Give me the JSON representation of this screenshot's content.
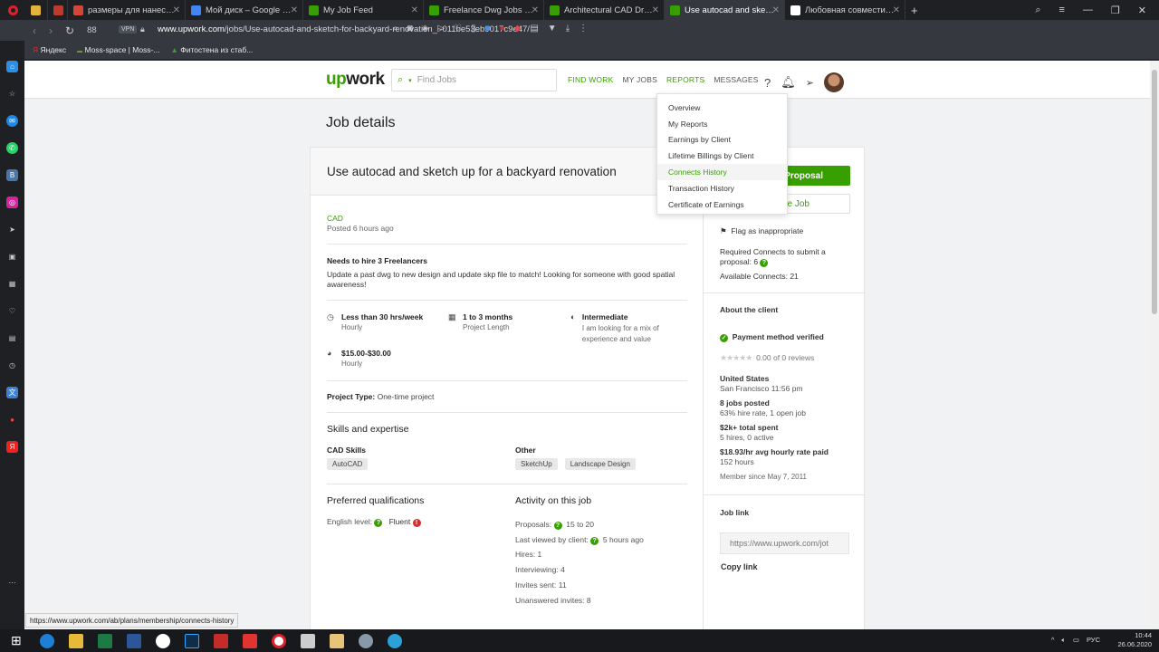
{
  "tabs": [
    {
      "title": "",
      "color": "#e3b33b"
    },
    {
      "title": "",
      "color": "#c0392b"
    },
    {
      "title": "размеры для нанесения с",
      "color": "#d44638"
    },
    {
      "title": "Мой диск – Google Диск",
      "color": "#4285f4"
    },
    {
      "title": "My Job Feed",
      "color": "#37a000"
    },
    {
      "title": "Freelance Dwg Jobs Online",
      "color": "#37a000"
    },
    {
      "title": "Architectural CAD Drawing",
      "color": "#37a000"
    },
    {
      "title": "Use autocad and sketch up",
      "color": "#37a000"
    },
    {
      "title": "Любовная совместимость",
      "color": "#ffffff"
    }
  ],
  "browser": {
    "tab_count": "88",
    "vpn": "VPN",
    "url_domain": "www.upwork.com",
    "url_path": "/jobs/Use-autocad-and-sketch-for-backyard-renovation_~011be53eb9017c9e47/",
    "bookmarks": [
      "Яндекс",
      "Moss-space | Moss-...",
      "Фитостена из стаб..."
    ],
    "status_url": "https://www.upwork.com/ab/plans/membership/connects-history"
  },
  "header": {
    "logo_up": "up",
    "logo_work": "work",
    "search_placeholder": "Find Jobs",
    "nav": [
      "FIND WORK",
      "MY JOBS",
      "REPORTS",
      "MESSAGES"
    ]
  },
  "page_title": "Job details",
  "job": {
    "title": "Use autocad and sketch up for a backyard renovation",
    "category": "CAD",
    "posted": "Posted 6 hours ago",
    "hire_heading": "Needs to hire 3 Freelancers",
    "description": "Update a past dwg to new design and update skp file to match! Looking for someone with good spatial awareness!",
    "hours": "Less than 30 hrs/week",
    "hours_sub": "Hourly",
    "length": "1 to 3 months",
    "length_sub": "Project Length",
    "level": "Intermediate",
    "level_sub": "I am looking for a mix of experience and value",
    "rate": "$15.00-$30.00",
    "rate_sub": "Hourly",
    "project_type_label": "Project Type:",
    "project_type": "One-time project",
    "skills_heading": "Skills and expertise",
    "cad_skills_label": "CAD Skills",
    "cad_skills": [
      "AutoCAD"
    ],
    "other_label": "Other",
    "other_skills": [
      "SketchUp",
      "Landscape Design"
    ],
    "pref_heading": "Preferred qualifications",
    "english_label": "English level:",
    "english_value": "Fluent",
    "activity_heading": "Activity on this job",
    "proposals_label": "Proposals:",
    "proposals_value": "15 to 20",
    "last_viewed_label": "Last viewed by client:",
    "last_viewed_value": "5 hours ago",
    "hires": "Hires: 1",
    "interviewing": "Interviewing: 4",
    "invites": "Invites sent: 11",
    "unanswered": "Unanswered invites: 8"
  },
  "sidebar": {
    "submit_btn": "Proposal",
    "save_btn": "e Job",
    "flag": "Flag as inappropriate",
    "connects_req": "Required Connects to submit a proposal: 6",
    "connects_avail": "Available Connects: 21",
    "about": "About the client",
    "payment": "Payment method verified",
    "reviews": "0.00 of 0 reviews",
    "country": "United States",
    "city": "San Francisco 11:56 pm",
    "jobs_posted": "8 jobs posted",
    "hire_rate": "63% hire rate, 1 open job",
    "spent": "$2k+ total spent",
    "spent_sub": "5 hires, 0 active",
    "avg_rate": "$18.93",
    "avg_rate_suffix": "/hr avg hourly rate paid",
    "hours": "152 hours",
    "member_since": "Member since May 7, 2011",
    "job_link_heading": "Job link",
    "job_link": "https://www.upwork.com/jot",
    "copy_link": "Copy link"
  },
  "dropdown": {
    "items": [
      "Overview",
      "My Reports",
      "Earnings by Client",
      "Lifetime Billings by Client",
      "Connects History",
      "Transaction History",
      "Certificate of Earnings"
    ]
  },
  "taskbar": {
    "lang": "РУС",
    "time": "10:44",
    "date": "26.06.2020"
  }
}
